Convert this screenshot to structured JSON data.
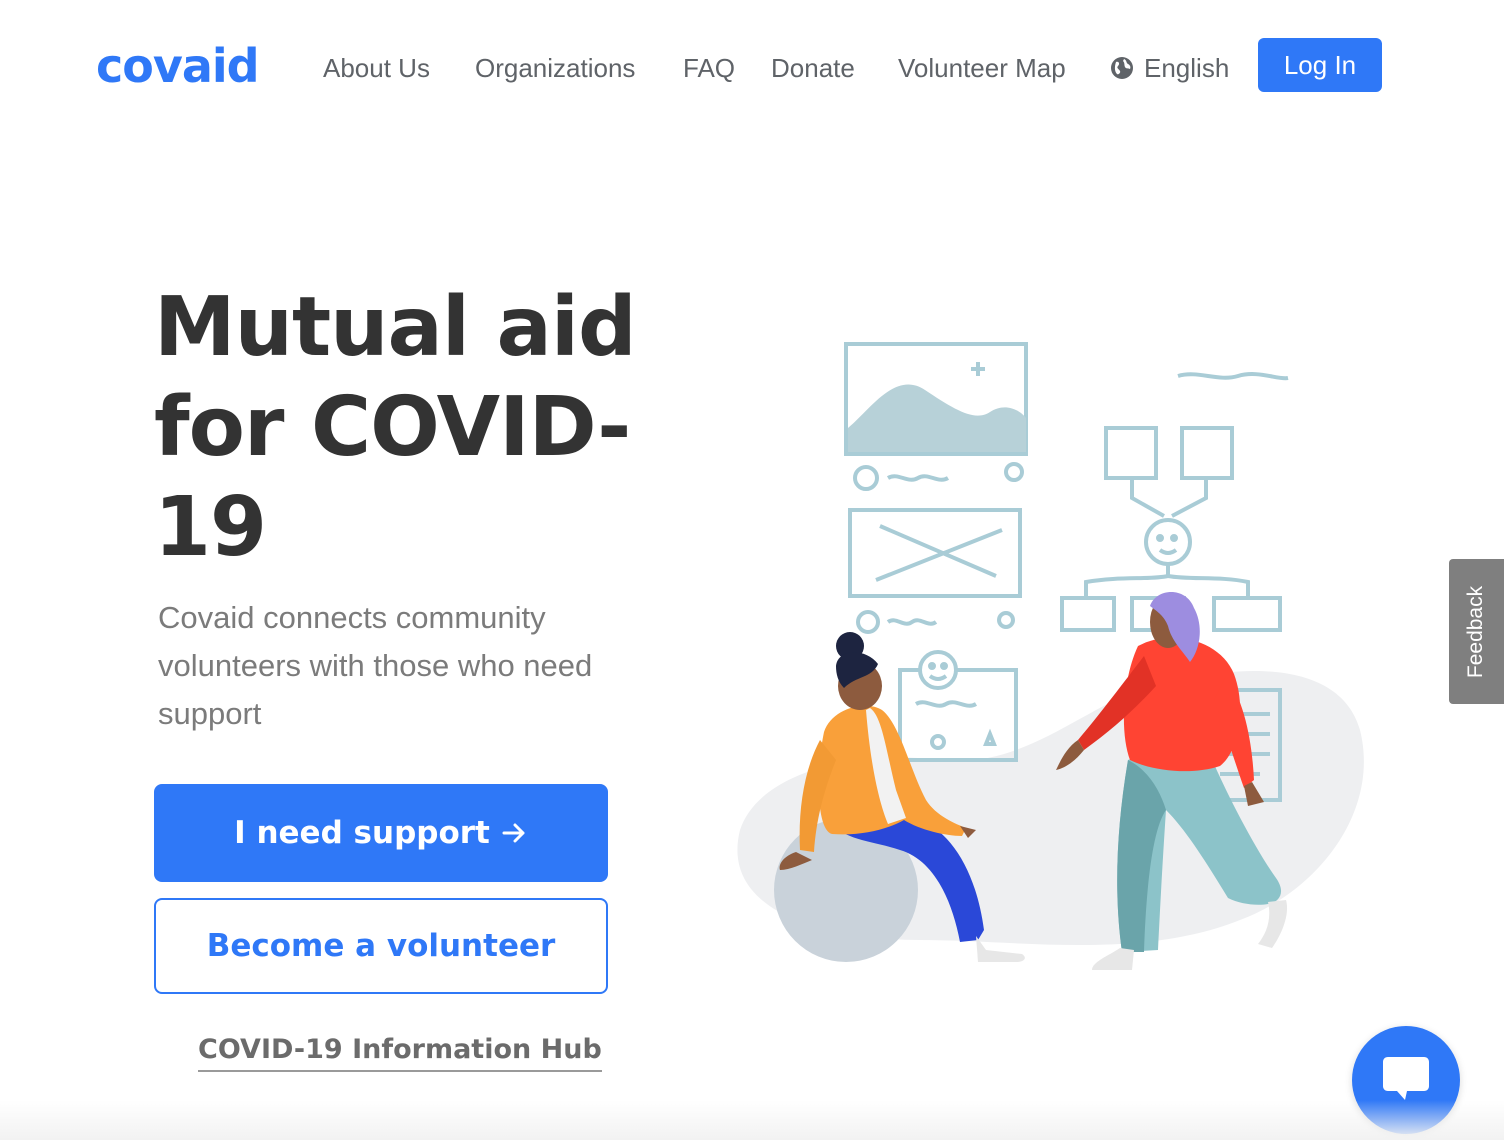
{
  "brand": {
    "logo_text": "covaid",
    "accent": "#2F78F7"
  },
  "nav": {
    "items": [
      {
        "label": "About Us"
      },
      {
        "label": "Organizations"
      },
      {
        "label": "FAQ"
      },
      {
        "label": "Donate"
      },
      {
        "label": "Volunteer Map"
      }
    ],
    "language": {
      "icon": "globe-icon",
      "label": "English"
    },
    "login_label": "Log In"
  },
  "hero": {
    "title": "Mutual aid for COVID-19",
    "subtitle": "Covaid connects community volunteers with those who need support",
    "primary_cta": "I need support",
    "primary_cta_icon": "arrow-right-icon",
    "secondary_cta": "Become a volunteer",
    "info_link": "COVID-19 Information Hub"
  },
  "feedback_tab": {
    "label": "Feedback"
  },
  "chat_widget": {
    "icon": "chat-bubble-icon"
  }
}
